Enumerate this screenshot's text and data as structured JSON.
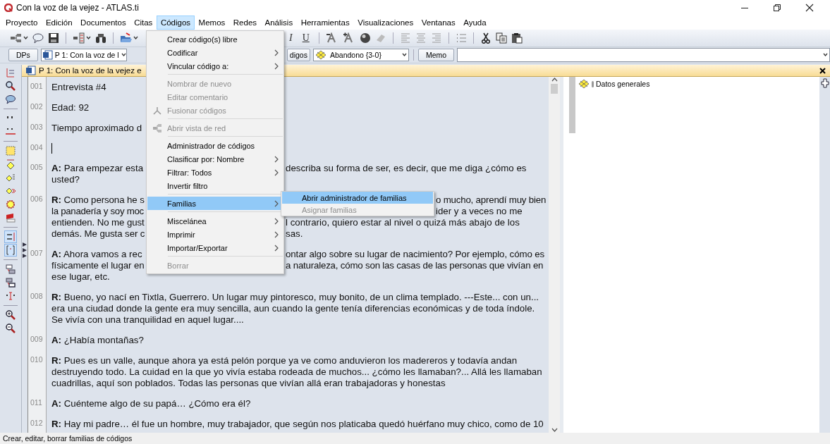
{
  "window": {
    "title": "Con la voz de la vejez - ATLAS.ti"
  },
  "menu_bar": [
    {
      "label": "Proyecto",
      "selected": false
    },
    {
      "label": "Edición",
      "selected": false
    },
    {
      "label": "Documentos",
      "selected": false
    },
    {
      "label": "Citas",
      "selected": false
    },
    {
      "label": "Códigos",
      "selected": true
    },
    {
      "label": "Memos",
      "selected": false
    },
    {
      "label": "Redes",
      "selected": false
    },
    {
      "label": "Análisis",
      "selected": false
    },
    {
      "label": "Herramientas",
      "selected": false
    },
    {
      "label": "Visualizaciones",
      "selected": false
    },
    {
      "label": "Ventanas",
      "selected": false
    },
    {
      "label": "Ayuda",
      "selected": false
    }
  ],
  "toolbar": {
    "italic_label": "I",
    "underline_label": "U"
  },
  "doc_bar": {
    "dps_button": "DPs",
    "document_select": "P 1: Con la voz de l",
    "codes_button": "digos",
    "code_select": "Abandono {3-0}",
    "memo_button": "Memo"
  },
  "document": {
    "header": "P 1: Con la voz de la vejez e",
    "paragraphs": [
      {
        "number": "001",
        "lines": [
          {
            "left": "Entrevista #4"
          }
        ]
      },
      {
        "number": "002",
        "lines": [
          {
            "left": "Edad: 92"
          }
        ]
      },
      {
        "number": "003",
        "lines": [
          {
            "left": "Tiempo aproximado d"
          }
        ]
      },
      {
        "number": "004",
        "cursor": true
      },
      {
        "number": "005",
        "lines": [
          {
            "left": "**A:** Para empezar esta",
            "right": "describa su forma de ser, es decir, que me diga ¿cómo es"
          },
          {
            "left": "usted?"
          }
        ]
      },
      {
        "number": "006",
        "lines": [
          {
            "left": "**R:** Como persona he s",
            "right": "o mucho, aprendí muy bien"
          },
          {
            "left": "la panadería y soy moc",
            "right": "ider y a veces no me"
          },
          {
            "left": "entienden. No me gust",
            "right": "l contrario, quiero estar al nivel o quizá más abajo de los"
          },
          {
            "left": "demás. Me gusta ser c",
            "right": "sas."
          }
        ]
      },
      {
        "number": "007",
        "lines": [
          {
            "left": "**A:** Ahora vamos a rec",
            "right": "ontar algo sobre su lugar de nacimiento? Por ejemplo, cómo es"
          },
          {
            "left": "físicamente el lugar en",
            "right": "a naturaleza, cómo son las casas de las personas que vivían en"
          },
          {
            "left": "ese lugar, etc."
          }
        ]
      },
      {
        "number": "008",
        "lines": [
          {
            "left": "**R:** Bueno, yo nací en Tixtla, Guerrero. Un lugar muy pintoresco, muy bonito, de un clima templado. ---Este... con un..."
          },
          {
            "left": "era una ciudad donde la gente era muy sencilla, aun cuando la gente tenía diferencias económicas y de toda índole."
          },
          {
            "left": "Se vivía con una tranquilidad en aquel lugar...."
          }
        ]
      },
      {
        "number": "009",
        "lines": [
          {
            "left": "**A:** ¿Había montañas?"
          }
        ]
      },
      {
        "number": "010",
        "lines": [
          {
            "left": "**R:** Pues es un valle, aunque ahora ya está pelón porque ya ve como anduvieron los madereros y todavía andan"
          },
          {
            "left": "destruyendo todo. La cuidad en la que yo vivía estaba rodeada de muchos... ¿cómo les llamaban?... Allá les llamaban"
          },
          {
            "left": "cuadrillas, aquí son poblados. Todas las personas que vivían allá eran trabajadoras y honestas"
          }
        ]
      },
      {
        "number": "011",
        "lines": [
          {
            "left": "**A:** Cuénteme algo de su papá… ¿Cómo era él?"
          }
        ]
      },
      {
        "number": "012",
        "lines": [
          {
            "left": "**R:** Hay mi padre… él fue un hombre, muy trabajador, que según nos platicaba quedó huérfano muy chico, como de 10"
          }
        ]
      }
    ]
  },
  "codes_pane": {
    "items": [
      {
        "label": "Datos generales"
      }
    ]
  },
  "codes_menu": {
    "items": [
      {
        "kind": "item",
        "label": "Crear código(s) libre",
        "disabled": false,
        "submenu": false,
        "selected": false
      },
      {
        "kind": "item",
        "label": "Codificar",
        "disabled": false,
        "submenu": true,
        "selected": false
      },
      {
        "kind": "item",
        "label": "Vincular código a:",
        "disabled": false,
        "submenu": true,
        "selected": false
      },
      {
        "kind": "separator"
      },
      {
        "kind": "item",
        "label": "Nombrar de nuevo",
        "disabled": true,
        "submenu": false,
        "selected": false
      },
      {
        "kind": "item",
        "label": "Editar comentario",
        "disabled": true,
        "submenu": false,
        "selected": false
      },
      {
        "kind": "item",
        "label": "Fusionar códigos",
        "disabled": true,
        "submenu": false,
        "selected": false
      },
      {
        "kind": "separator"
      },
      {
        "kind": "item",
        "label": "Abrir vista de red",
        "disabled": true,
        "submenu": false,
        "selected": false
      },
      {
        "kind": "separator"
      },
      {
        "kind": "item",
        "label": "Administrador de códigos",
        "disabled": false,
        "submenu": false,
        "selected": false
      },
      {
        "kind": "item",
        "label": "Clasificar por: Nombre",
        "disabled": false,
        "submenu": true,
        "selected": false
      },
      {
        "kind": "item",
        "label": "Filtrar: Todos",
        "disabled": false,
        "submenu": true,
        "selected": false
      },
      {
        "kind": "item",
        "label": "Invertir filtro",
        "disabled": false,
        "submenu": false,
        "selected": false
      },
      {
        "kind": "separator"
      },
      {
        "kind": "item",
        "label": "Familias",
        "disabled": false,
        "submenu": true,
        "selected": true
      },
      {
        "kind": "separator"
      },
      {
        "kind": "item",
        "label": "Miscelánea",
        "disabled": false,
        "submenu": true,
        "selected": false
      },
      {
        "kind": "item",
        "label": "Imprimir",
        "disabled": false,
        "submenu": true,
        "selected": false
      },
      {
        "kind": "item",
        "label": "Importar/Exportar",
        "disabled": false,
        "submenu": true,
        "selected": false
      },
      {
        "kind": "separator"
      },
      {
        "kind": "item",
        "label": "Borrar",
        "disabled": true,
        "submenu": false,
        "selected": false
      }
    ]
  },
  "families_submenu": {
    "items": [
      {
        "kind": "item",
        "label": "Abrir administrador de familias",
        "disabled": false,
        "submenu": false,
        "selected": true
      },
      {
        "kind": "item",
        "label": "Asignar familias",
        "disabled": true,
        "submenu": false,
        "selected": false
      }
    ]
  },
  "status_bar": "Crear, editar, borrar familias de códigos"
}
